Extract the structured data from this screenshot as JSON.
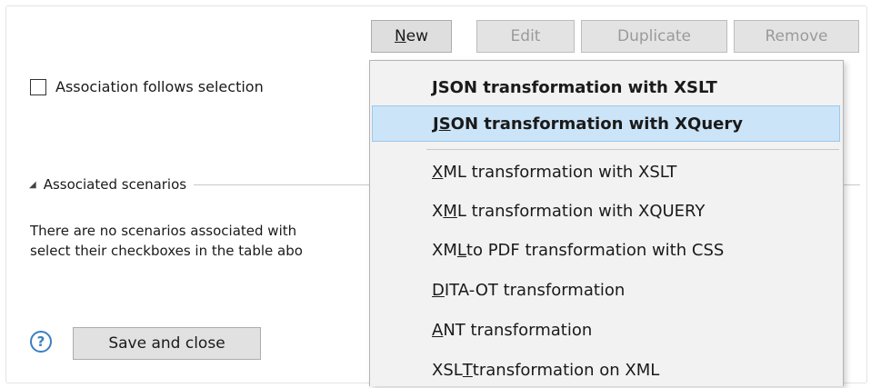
{
  "toolbar": {
    "new": {
      "pre": "",
      "ul": "N",
      "post": "ew"
    },
    "edit": "Edit",
    "duplicate": "Duplicate",
    "remove": "Remove"
  },
  "association": {
    "checkbox_label": "Association follows selection",
    "checked": false
  },
  "associated": {
    "header": "Associated scenarios",
    "message_line1": "There are no scenarios associated with",
    "message_line2": "select their checkboxes in the table abo"
  },
  "footer": {
    "help": "?",
    "save_label": "Save and close"
  },
  "menu": {
    "items": [
      {
        "pre": "",
        "ul": "J",
        "post": "SON transformation with XSLT"
      },
      {
        "pre": "J",
        "ul": "S",
        "post": "ON transformation with XQuery"
      },
      {
        "pre": "",
        "ul": "X",
        "post": "ML transformation with XSLT"
      },
      {
        "pre": "X",
        "ul": "M",
        "post": "L transformation with XQUERY"
      },
      {
        "pre": "XM",
        "ul": "L",
        "post": " to PDF transformation with CSS"
      },
      {
        "pre": "",
        "ul": "D",
        "post": "ITA-OT transformation"
      },
      {
        "pre": "",
        "ul": "A",
        "post": "NT transformation"
      },
      {
        "pre": "XSL",
        "ul": "T",
        "post": " transformation on XML"
      }
    ]
  }
}
